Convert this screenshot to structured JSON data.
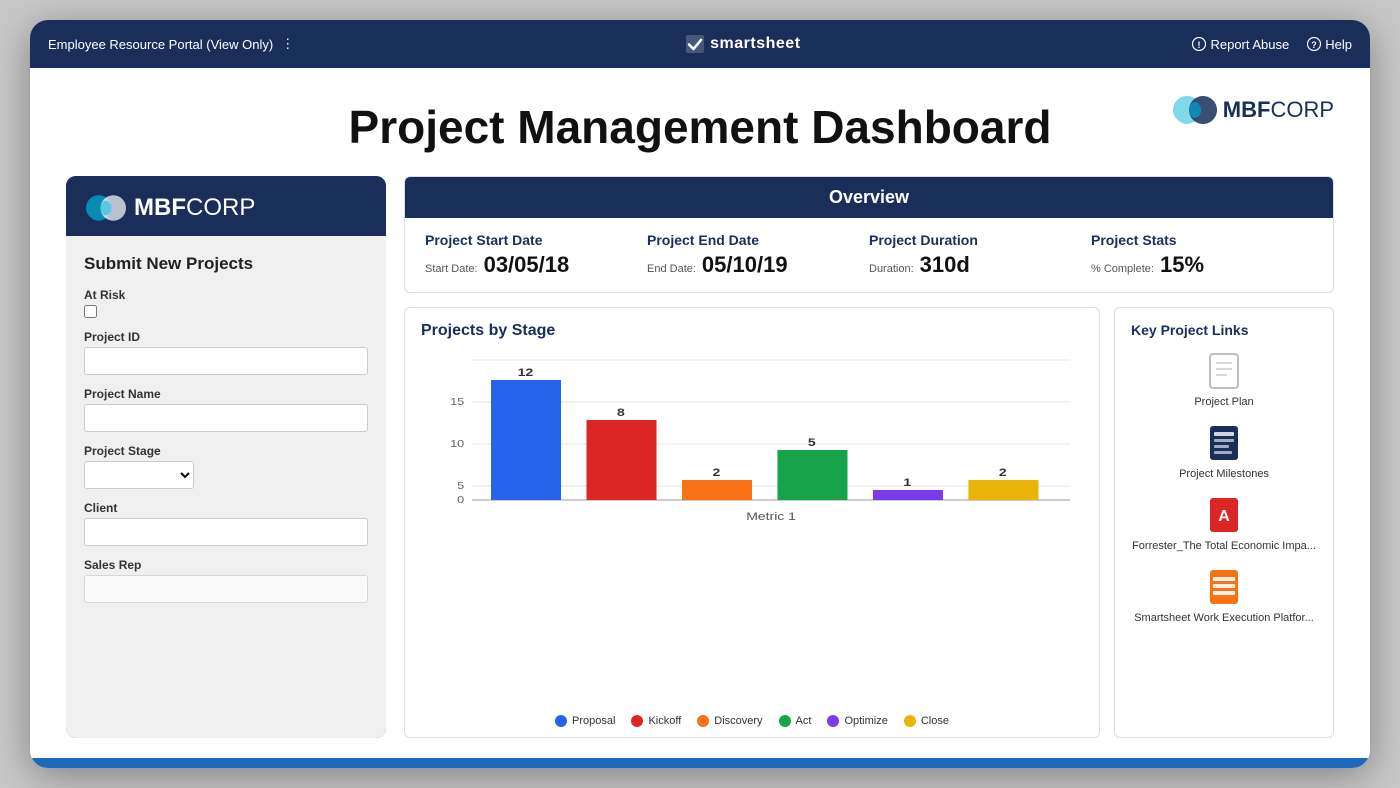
{
  "topbar": {
    "title": "Employee Resource Portal (View Only)",
    "dots_icon": "⋮",
    "brand": "smartsheet",
    "report_abuse": "Report Abuse",
    "help": "Help"
  },
  "page": {
    "title": "Project Management Dashboard"
  },
  "mbfcorp": {
    "name_bold": "MBF",
    "name_light": "CORP"
  },
  "form": {
    "section_title": "Submit New Projects",
    "at_risk_label": "At Risk",
    "project_id_label": "Project ID",
    "project_name_label": "Project Name",
    "project_stage_label": "Project Stage",
    "client_label": "Client",
    "sales_rep_label": "Sales Rep"
  },
  "overview": {
    "header": "Overview",
    "start_date_label": "Project Start Date",
    "start_date_sublabel": "Start Date:",
    "start_date_value": "03/05/18",
    "end_date_label": "Project End Date",
    "end_date_sublabel": "End Date:",
    "end_date_value": "05/10/19",
    "duration_label": "Project Duration",
    "duration_sublabel": "Duration:",
    "duration_value": "310d",
    "stats_label": "Project Stats",
    "stats_sublabel": "% Complete:",
    "stats_value": "15%"
  },
  "chart": {
    "title": "Projects by Stage",
    "x_label": "Metric 1",
    "bars": [
      {
        "label": "Proposal",
        "value": 12,
        "color": "#2563eb"
      },
      {
        "label": "Kickoff",
        "value": 8,
        "color": "#dc2626"
      },
      {
        "label": "Discovery",
        "value": 2,
        "color": "#f97316"
      },
      {
        "label": "Act",
        "value": 5,
        "color": "#16a34a"
      },
      {
        "label": "Optimize",
        "value": 1,
        "color": "#7c3aed"
      },
      {
        "label": "Close",
        "value": 2,
        "color": "#eab308"
      }
    ],
    "y_max": 15,
    "y_ticks": [
      0,
      5,
      10,
      15
    ]
  },
  "key_links": {
    "title": "Key Project Links",
    "items": [
      {
        "label": "Project Plan",
        "icon_type": "doc",
        "color": "#aaa"
      },
      {
        "label": "Project Milestones",
        "icon_type": "book",
        "color": "#1a2e5a"
      },
      {
        "label": "Forrester_The Total Economic Impa...",
        "icon_type": "pdf",
        "color": "#dc2626"
      },
      {
        "label": "Smartsheet Work Execution Platfor...",
        "icon_type": "sheet",
        "color": "#f97316"
      }
    ]
  }
}
